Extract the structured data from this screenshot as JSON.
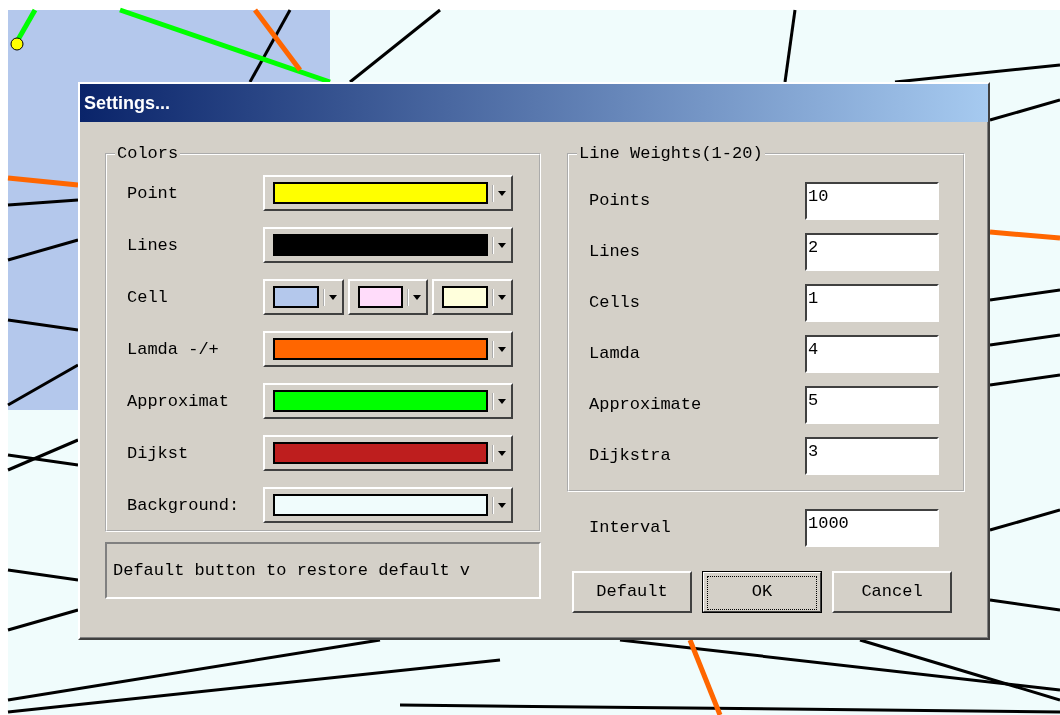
{
  "dialog": {
    "title": "Settings..."
  },
  "colors": {
    "title": "Colors",
    "rows": [
      {
        "label": "Point",
        "swatches": [
          {
            "color": "#ffff00"
          }
        ]
      },
      {
        "label": "Lines",
        "swatches": [
          {
            "color": "#000000"
          }
        ]
      },
      {
        "label": "Cell",
        "swatches": [
          {
            "color": "#b4c8ec"
          },
          {
            "color": "#ffdcfa"
          },
          {
            "color": "#ffffdc"
          }
        ]
      },
      {
        "label": "Lamda -/+",
        "swatches": [
          {
            "color": "#ff6600"
          }
        ]
      },
      {
        "label": "Approximat",
        "swatches": [
          {
            "color": "#00ff00"
          }
        ]
      },
      {
        "label": "Dijkst",
        "swatches": [
          {
            "color": "#be1e1e"
          }
        ]
      },
      {
        "label": "Background:",
        "swatches": [
          {
            "color": "#f0fcfc"
          }
        ]
      }
    ]
  },
  "hint": "Default button to restore default v",
  "line_weights": {
    "title": "Line Weights(1-20)",
    "rows": [
      {
        "label": "Points",
        "value": "10"
      },
      {
        "label": "Lines",
        "value": "2"
      },
      {
        "label": "Cells",
        "value": "1"
      },
      {
        "label": "Lamda",
        "value": "4"
      },
      {
        "label": "Approximate",
        "value": "5"
      },
      {
        "label": "Dijkstra",
        "value": "3"
      }
    ]
  },
  "interval": {
    "label": "Interval",
    "value": "1000"
  },
  "buttons": [
    {
      "label": "Default",
      "focused": false
    },
    {
      "label": "OK",
      "focused": true
    },
    {
      "label": "Cancel",
      "focused": false
    }
  ]
}
